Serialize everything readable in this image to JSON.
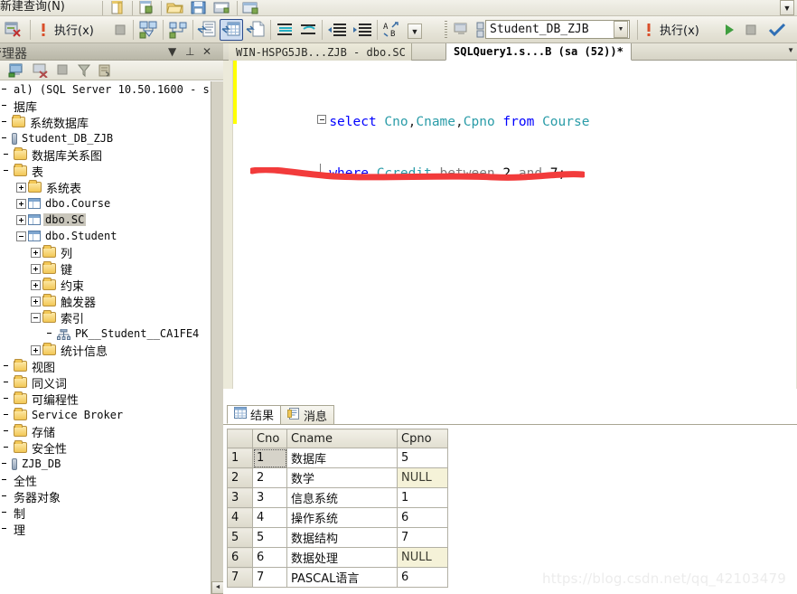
{
  "toolbar_top": {
    "new_query_label": "新建查询(N)",
    "icons": [
      "new-file-icon",
      "new-project-icon",
      "open-folder-icon",
      "save-icon",
      "save-all-icon",
      "window-icon"
    ],
    "overflow_label": "▼"
  },
  "toolbar_main": {
    "debug_stop_icon": "debug-stop-icon",
    "execute_bang_icon": "execute-bang-icon",
    "execute_label": "执行(x)",
    "stop_icon": "stop-square-icon",
    "parse_icon": "parse-check-icon",
    "plan_icon": "display-estimated-plan-icon",
    "results_to_text_icon": "results-to-text-icon",
    "results_to_grid_icon": "results-to-grid-icon",
    "results_to_file_icon": "results-to-file-icon",
    "comment_icon": "comment-lines-icon",
    "uncomment_icon": "uncomment-lines-icon",
    "indent_icon": "increase-indent-icon",
    "outdent_icon": "decrease-indent-icon",
    "spell_icon": "spell-check-icon",
    "overflow_label": "▼",
    "connect_icon": "connect-server-icon",
    "disconnect_icon": "disconnect-server-icon",
    "database_selected": "Student_DB_ZJB",
    "database_dropdown_arrow": "▼",
    "run_arrow_icon": "run-green-arrow-icon",
    "cancel_icon": "cancel-grey-square-icon",
    "check_icon": "blue-check-icon"
  },
  "object_explorer": {
    "title": "资源管理器",
    "dropdown_icon": "▼",
    "pin_icon": "⊥",
    "close_icon": "✕",
    "subbar_icons": [
      "connect-icon",
      "disconnect-icon",
      "stop-icon",
      "filter-funnel-icon",
      "refresh-script-icon"
    ],
    "tree": [
      {
        "indent": 0,
        "expander": "none",
        "icon": "none",
        "label": "al) (SQL Server 10.50.1600 - s",
        "mono": true,
        "selected": false
      },
      {
        "indent": 0,
        "expander": "none",
        "icon": "none",
        "label": "据库",
        "mono": false,
        "selected": false
      },
      {
        "indent": 0,
        "expander": "none",
        "icon": "folder",
        "label": "系统数据库",
        "mono": false,
        "selected": false
      },
      {
        "indent": 0,
        "expander": "none",
        "icon": "dbcyl",
        "label": "Student_DB_ZJB",
        "mono": true,
        "selected": false
      },
      {
        "indent": 1,
        "expander": "none",
        "icon": "folder",
        "label": "数据库关系图",
        "mono": false,
        "selected": false
      },
      {
        "indent": 1,
        "expander": "none",
        "icon": "folder",
        "label": "表",
        "mono": false,
        "selected": false
      },
      {
        "indent": 2,
        "expander": "plus",
        "icon": "folder",
        "label": "系统表",
        "mono": false,
        "selected": false
      },
      {
        "indent": 2,
        "expander": "plus",
        "icon": "table",
        "label": "dbo.Course",
        "mono": true,
        "selected": false
      },
      {
        "indent": 2,
        "expander": "plus",
        "icon": "table",
        "label": "dbo.SC",
        "mono": true,
        "selected": true
      },
      {
        "indent": 2,
        "expander": "minus",
        "icon": "table",
        "label": "dbo.Student",
        "mono": true,
        "selected": false
      },
      {
        "indent": 3,
        "expander": "plus",
        "icon": "folder",
        "label": "列",
        "mono": false,
        "selected": false
      },
      {
        "indent": 3,
        "expander": "plus",
        "icon": "folder",
        "label": "键",
        "mono": false,
        "selected": false
      },
      {
        "indent": 3,
        "expander": "plus",
        "icon": "folder",
        "label": "约束",
        "mono": false,
        "selected": false
      },
      {
        "indent": 3,
        "expander": "plus",
        "icon": "folder",
        "label": "触发器",
        "mono": false,
        "selected": false
      },
      {
        "indent": 3,
        "expander": "minus",
        "icon": "folder",
        "label": "索引",
        "mono": false,
        "selected": false
      },
      {
        "indent": 4,
        "expander": "none",
        "icon": "key",
        "label": "PK__Student__CA1FE4",
        "mono": true,
        "selected": false
      },
      {
        "indent": 3,
        "expander": "plus",
        "icon": "folder",
        "label": "统计信息",
        "mono": false,
        "selected": false
      },
      {
        "indent": 1,
        "expander": "none",
        "icon": "folder",
        "label": "视图",
        "mono": false,
        "selected": false
      },
      {
        "indent": 1,
        "expander": "none",
        "icon": "folder",
        "label": "同义词",
        "mono": false,
        "selected": false
      },
      {
        "indent": 1,
        "expander": "none",
        "icon": "folder",
        "label": "可编程性",
        "mono": false,
        "selected": false
      },
      {
        "indent": 1,
        "expander": "none",
        "icon": "folder",
        "label": "Service Broker",
        "mono": true,
        "selected": false
      },
      {
        "indent": 1,
        "expander": "none",
        "icon": "folder",
        "label": "存储",
        "mono": false,
        "selected": false
      },
      {
        "indent": 1,
        "expander": "none",
        "icon": "folder",
        "label": "安全性",
        "mono": false,
        "selected": false
      },
      {
        "indent": 0,
        "expander": "none",
        "icon": "dbcyl",
        "label": "ZJB_DB",
        "mono": true,
        "selected": false
      },
      {
        "indent": 0,
        "expander": "none",
        "icon": "none",
        "label": "全性",
        "mono": false,
        "selected": false
      },
      {
        "indent": 0,
        "expander": "none",
        "icon": "none",
        "label": "务器对象",
        "mono": false,
        "selected": false
      },
      {
        "indent": 0,
        "expander": "none",
        "icon": "none",
        "label": "制",
        "mono": false,
        "selected": false
      },
      {
        "indent": 0,
        "expander": "none",
        "icon": "none",
        "label": "理",
        "mono": false,
        "selected": false
      }
    ],
    "scroll_down_label": "◄"
  },
  "editor": {
    "tabs": [
      {
        "label": "WIN-HSPG5JB...ZJB - dbo.SC",
        "active": false
      },
      {
        "label": "SQLQuery1.s...B (sa (52))*",
        "active": true
      }
    ],
    "tab_dropdown_icon": "▼",
    "code": {
      "line1": [
        {
          "text": "select ",
          "cls": "kw"
        },
        {
          "text": "Cno",
          "cls": "id"
        },
        {
          "text": ",",
          "cls": "punct"
        },
        {
          "text": "Cname",
          "cls": "id"
        },
        {
          "text": ",",
          "cls": "punct"
        },
        {
          "text": "Cpno ",
          "cls": "id"
        },
        {
          "text": "from ",
          "cls": "kw"
        },
        {
          "text": "Course",
          "cls": "id"
        }
      ],
      "line2": [
        {
          "text": "where ",
          "cls": "kw"
        },
        {
          "text": "Ccredit ",
          "cls": "id"
        },
        {
          "text": "between ",
          "cls": "plain"
        },
        {
          "text": "2",
          "cls": "num"
        },
        {
          "text": " and ",
          "cls": "plain"
        },
        {
          "text": "7;",
          "cls": "num"
        }
      ]
    },
    "annotation_color": "#f23b3b",
    "hscroll_left_label": "◄",
    "hscroll_right_label": "►"
  },
  "results": {
    "tabs": [
      {
        "label": "结果",
        "icon": "grid-icon",
        "active": true
      },
      {
        "label": "消息",
        "icon": "message-icon",
        "active": false
      }
    ],
    "grid": {
      "columns": [
        "Cno",
        "Cname",
        "Cpno"
      ],
      "rows": [
        {
          "n": "1",
          "Cno": "1",
          "Cname": "数据库",
          "Cpno": "5"
        },
        {
          "n": "2",
          "Cno": "2",
          "Cname": "数学",
          "Cpno": "NULL"
        },
        {
          "n": "3",
          "Cno": "3",
          "Cname": "信息系统",
          "Cpno": "1"
        },
        {
          "n": "4",
          "Cno": "4",
          "Cname": "操作系统",
          "Cpno": "6"
        },
        {
          "n": "5",
          "Cno": "5",
          "Cname": "数据结构",
          "Cpno": "7"
        },
        {
          "n": "6",
          "Cno": "6",
          "Cname": "数据处理",
          "Cpno": "NULL"
        },
        {
          "n": "7",
          "Cno": "7",
          "Cname": "PASCAL语言",
          "Cpno": "6"
        }
      ]
    }
  },
  "watermark": "https://blog.csdn.net/qq_42103479"
}
